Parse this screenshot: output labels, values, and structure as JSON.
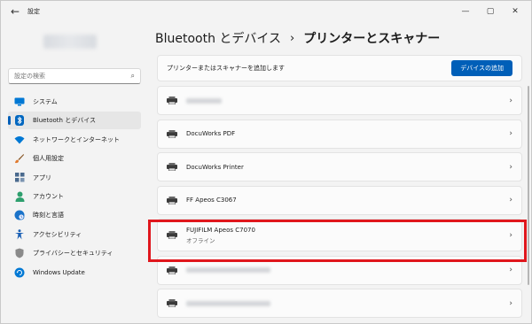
{
  "titlebar": {
    "back_label": "←",
    "app_title": "設定",
    "minimize": "—",
    "maximize": "▢",
    "close": "✕"
  },
  "search": {
    "placeholder": "設定の検索",
    "icon": "search-icon"
  },
  "sidebar": {
    "items": [
      {
        "label": "システム",
        "icon": "monitor-icon",
        "color": "#0078d4"
      },
      {
        "label": "Bluetooth とデバイス",
        "icon": "bluetooth-icon",
        "color": "#0067c0",
        "active": true
      },
      {
        "label": "ネットワークとインターネット",
        "icon": "wifi-icon",
        "color": "#0078d4"
      },
      {
        "label": "個人用設定",
        "icon": "brush-icon",
        "color": "#d8752b"
      },
      {
        "label": "アプリ",
        "icon": "apps-icon",
        "color": "#4a6a8e"
      },
      {
        "label": "アカウント",
        "icon": "person-icon",
        "color": "#2e9f6e"
      },
      {
        "label": "時刻と言語",
        "icon": "globe-icon",
        "color": "#1a73c9"
      },
      {
        "label": "アクセシビリティ",
        "icon": "accessibility-icon",
        "color": "#1a5fb4"
      },
      {
        "label": "プライバシーとセキュリティ",
        "icon": "shield-icon",
        "color": "#6b6b6b"
      },
      {
        "label": "Windows Update",
        "icon": "update-icon",
        "color": "#0078d4"
      }
    ]
  },
  "header": {
    "crumb_parent": "Bluetooth とデバイス",
    "crumb_sep": "›",
    "crumb_current": "プリンターとスキャナー"
  },
  "add_section": {
    "label": "プリンターまたはスキャナーを追加します",
    "button": "デバイスの追加"
  },
  "printers": [
    {
      "name": "",
      "status": "",
      "blurred": true
    },
    {
      "name": "DocuWorks PDF",
      "status": ""
    },
    {
      "name": "DocuWorks Printer",
      "status": ""
    },
    {
      "name": "FF Apeos C3067",
      "status": ""
    },
    {
      "name": "FUJIFILM Apeos C7070",
      "status": "オフライン"
    },
    {
      "name": "",
      "status": "",
      "blurred": true,
      "wide": true
    },
    {
      "name": "",
      "status": "",
      "blurred": true,
      "wide": true
    }
  ],
  "chevron": "›",
  "colors": {
    "accent": "#005fb8",
    "highlight": "#e0161c"
  }
}
